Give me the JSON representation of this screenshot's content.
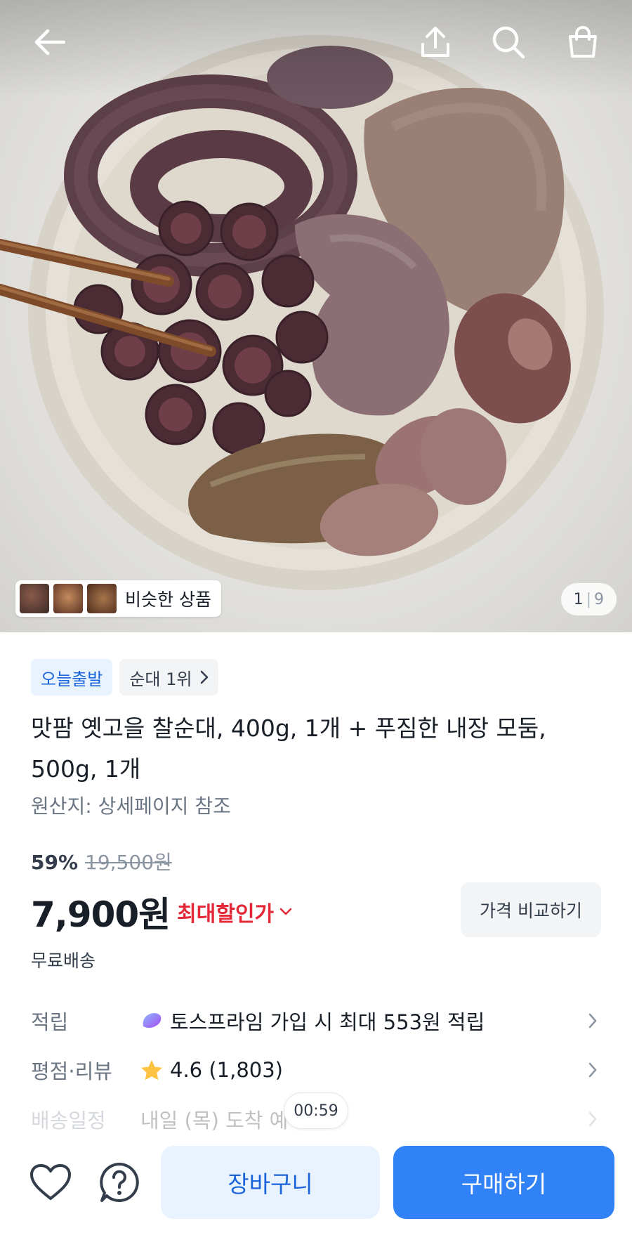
{
  "hero": {
    "similar_label": "비슷한 상품",
    "counter_current": "1",
    "counter_total": "9"
  },
  "icons": {
    "back": "arrow-left-icon",
    "share": "share-upload-icon",
    "search": "search-icon",
    "cart": "shopping-bag-icon",
    "wishlist": "heart-icon",
    "help": "question-icon",
    "chevron": "chevron-right-icon"
  },
  "badges": {
    "today_ship": "오늘출발",
    "rank": "순대 1위"
  },
  "product": {
    "title": "맛팜 옛고을 찰순대, 400g, 1개 + 푸짐한 내장 모둠, 500g, 1개",
    "origin": "원산지: 상세페이지 참조",
    "discount_pct": "59%",
    "original_price": "19,500원",
    "price": "7,900원",
    "max_discount_label": "최대할인가",
    "compare_label": "가격 비교하기",
    "shipping": "무료배송"
  },
  "info_rows": [
    {
      "key": "적립",
      "value": "토스프라임 가입 시 최대 553원 적립"
    },
    {
      "key": "평점·리뷰",
      "value": "4.6 (1,803)"
    },
    {
      "key": "배송일정",
      "value": "내일 (목) 도착 예"
    }
  ],
  "timer": "00:59",
  "actions": {
    "cart": "장바구니",
    "buy": "구매하기"
  },
  "colors": {
    "primary": "#3182f6",
    "primary_light": "#e8f3ff",
    "discount_red": "#e42939",
    "star": "#ffc342",
    "text_main": "#191f28",
    "text_sub": "#6b7684"
  }
}
